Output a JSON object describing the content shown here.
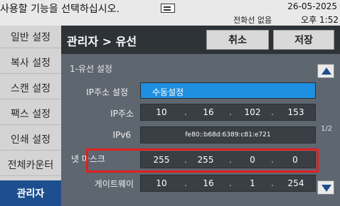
{
  "top": {
    "message": "사용할 기능을 선택하십시오.",
    "date": "26-05-2025",
    "status": "전화선 없음",
    "time": "오후 1:52",
    "icon": "document-queue-icon"
  },
  "sidebar": {
    "items": [
      {
        "label": "일반 설정"
      },
      {
        "label": "복사 설정"
      },
      {
        "label": "스캔 설정"
      },
      {
        "label": "팩스 설정"
      },
      {
        "label": "인쇄 설정"
      },
      {
        "label": "전체카운터"
      },
      {
        "label": "관리자",
        "active": true
      }
    ]
  },
  "header": {
    "title": "관리자 > 유선",
    "cancel_label": "취소",
    "save_label": "저장"
  },
  "section": {
    "title": "1-유선 설정",
    "page_indicator": "1/2"
  },
  "rows": {
    "ip_setting": {
      "label": "IP주소 설정",
      "value": "수동설정"
    },
    "ip_address": {
      "label": "IP주소",
      "segments": [
        "10",
        "16",
        "102",
        "153"
      ]
    },
    "ipv6": {
      "label": "IPv6",
      "value": "fe80::b68d:6389:c81:e721"
    },
    "netmask": {
      "label": "넷 마스크",
      "segments": [
        "255",
        "255",
        "0",
        "0"
      ]
    },
    "gateway": {
      "label": "게이트웨이",
      "segments": [
        "10",
        "16",
        "1",
        "254"
      ]
    }
  },
  "colors": {
    "accent_blue": "#1f8fe0",
    "sidebar_active": "#1d4e8f",
    "highlight_red": "#e02020"
  }
}
